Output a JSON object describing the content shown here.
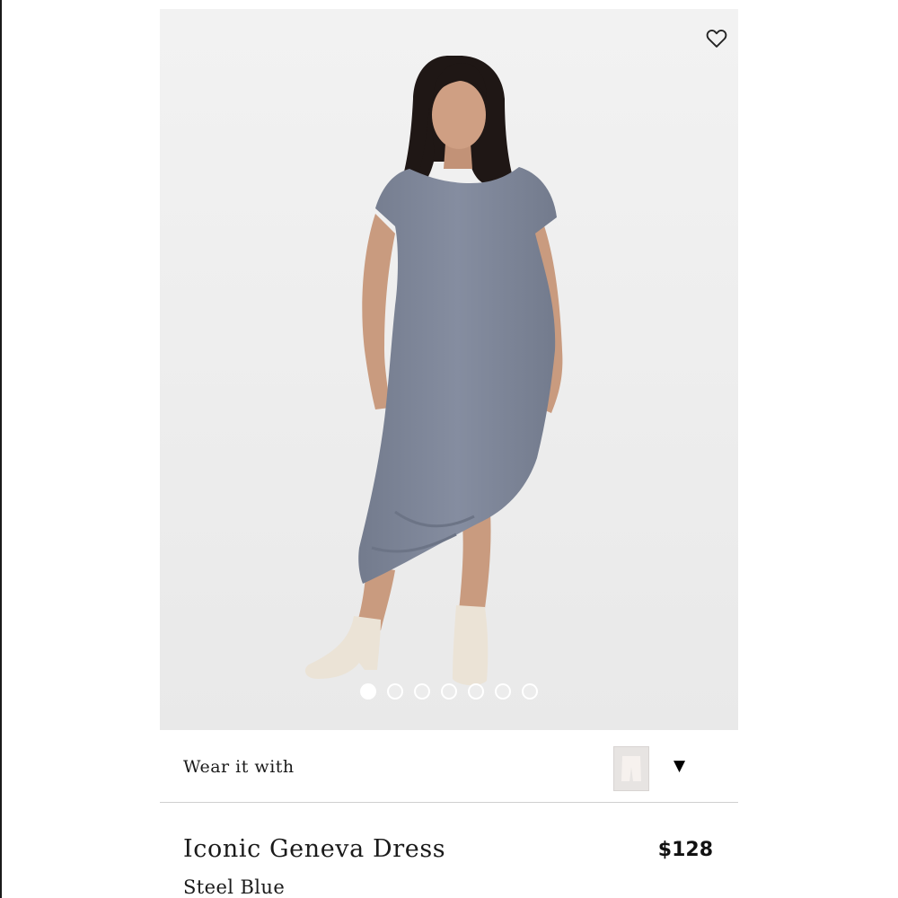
{
  "product": {
    "name": "Iconic Geneva Dress",
    "color": "Steel Blue",
    "price": "$128"
  },
  "gallery": {
    "image_count": 7,
    "active_index": 0,
    "wishlist_icon": "heart-outline-icon"
  },
  "wear_it_with": {
    "label": "Wear it with",
    "toggle_icon": "caret-down-icon",
    "toggle_glyph": "▼"
  },
  "colors": {
    "dress": "#7f8799",
    "background": "#efefef",
    "divider": "#cfcfcf"
  }
}
